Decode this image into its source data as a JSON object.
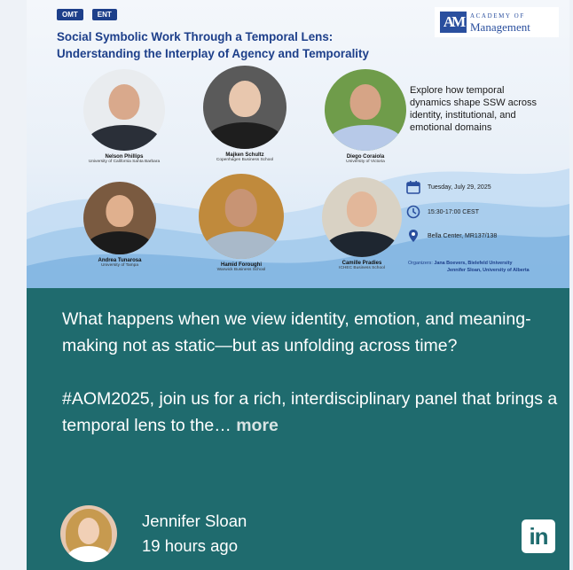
{
  "banner": {
    "tags": [
      "OMT",
      "ENT"
    ],
    "title_line1": "Social Symbolic Work Through a Temporal Lens:",
    "title_line2": "Understanding the Interplay of Agency and Temporality",
    "logo_top": "ACADEMY OF",
    "logo_bottom": "Management",
    "logo_mark": "AM",
    "speakers": [
      {
        "name": "Nelson Phillips",
        "affiliation": "University of California Santa Barbara"
      },
      {
        "name": "Majken Schultz",
        "affiliation": "Copenhagen Business School"
      },
      {
        "name": "Diego Coraiola",
        "affiliation": "University of Victoria"
      },
      {
        "name": "Andrea Tunarosa",
        "affiliation": "University of Tampa"
      },
      {
        "name": "Hamid Foroughi",
        "affiliation": "Warwick Business School"
      },
      {
        "name": "Camille Pradies",
        "affiliation": "ICHEC Business School"
      }
    ],
    "explore": "Explore how temporal dynamics shape SSW across identity, institutional, and emotional domains",
    "date": "Tuesday, July 29, 2025",
    "time": "15:30-17:00 CEST",
    "location": "Bella Center, MR137/138",
    "organizers_label": "Organizers:",
    "organizer1": "Jana Boevers, Bielefeld University",
    "organizer2": "Jennifer Sloan, University of Alberta"
  },
  "post": {
    "paragraph1": "What happens when we view identity, emotion, and meaning-making not as static—but as unfolding across time?",
    "paragraph2_text": "#AOM2025, join us for a rich, interdisciplinary panel that brings a temporal lens to the…",
    "more_label": "more"
  },
  "author": {
    "name": "Jennifer Sloan",
    "time_ago": "19 hours ago"
  },
  "linkedin_label": "in",
  "colors": {
    "card_bg": "#1f6b6e",
    "title_blue": "#1d3f8a",
    "linkedin_bg": "#ffffff"
  }
}
